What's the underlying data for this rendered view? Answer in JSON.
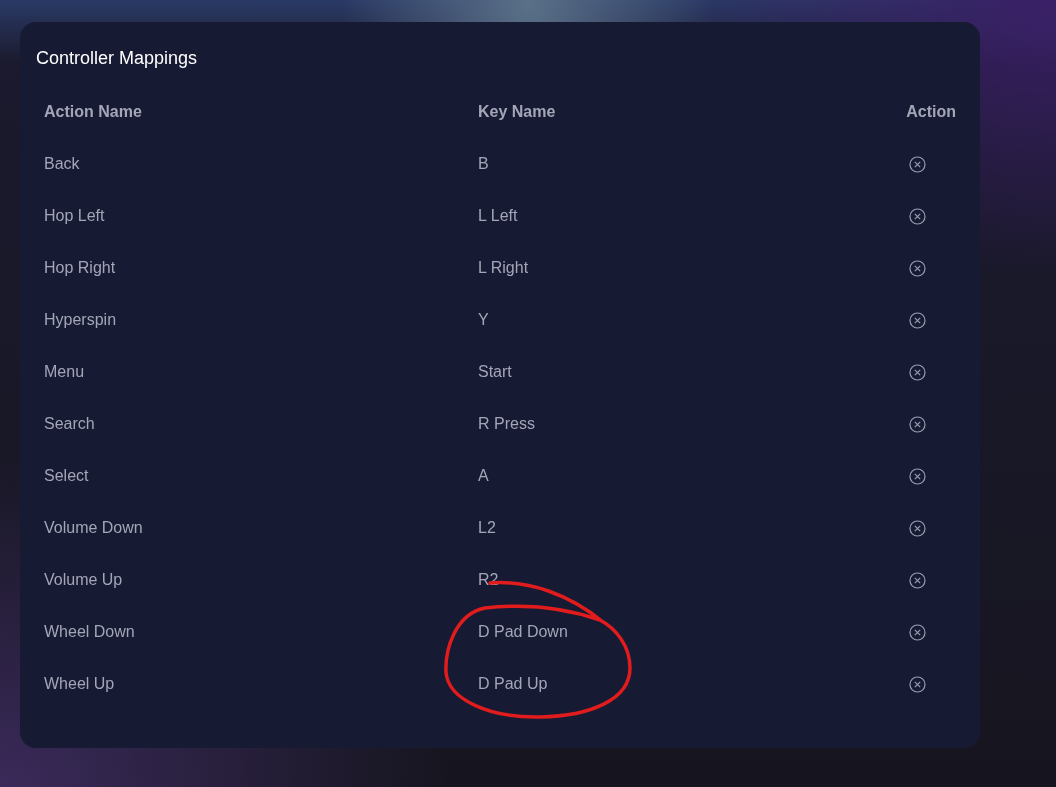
{
  "title": "Controller Mappings",
  "table": {
    "columns": [
      "Action Name",
      "Key Name",
      "Action"
    ],
    "rows": [
      {
        "action_name": "Back",
        "key_name": "B"
      },
      {
        "action_name": "Hop Left",
        "key_name": "L Left"
      },
      {
        "action_name": "Hop Right",
        "key_name": "L Right"
      },
      {
        "action_name": "Hyperspin",
        "key_name": "Y"
      },
      {
        "action_name": "Menu",
        "key_name": "Start"
      },
      {
        "action_name": "Search",
        "key_name": "R Press"
      },
      {
        "action_name": "Select",
        "key_name": "A"
      },
      {
        "action_name": "Volume Down",
        "key_name": "L2"
      },
      {
        "action_name": "Volume Up",
        "key_name": "R2"
      },
      {
        "action_name": "Wheel Down",
        "key_name": "D Pad Down"
      },
      {
        "action_name": "Wheel Up",
        "key_name": "D Pad Up"
      }
    ]
  }
}
